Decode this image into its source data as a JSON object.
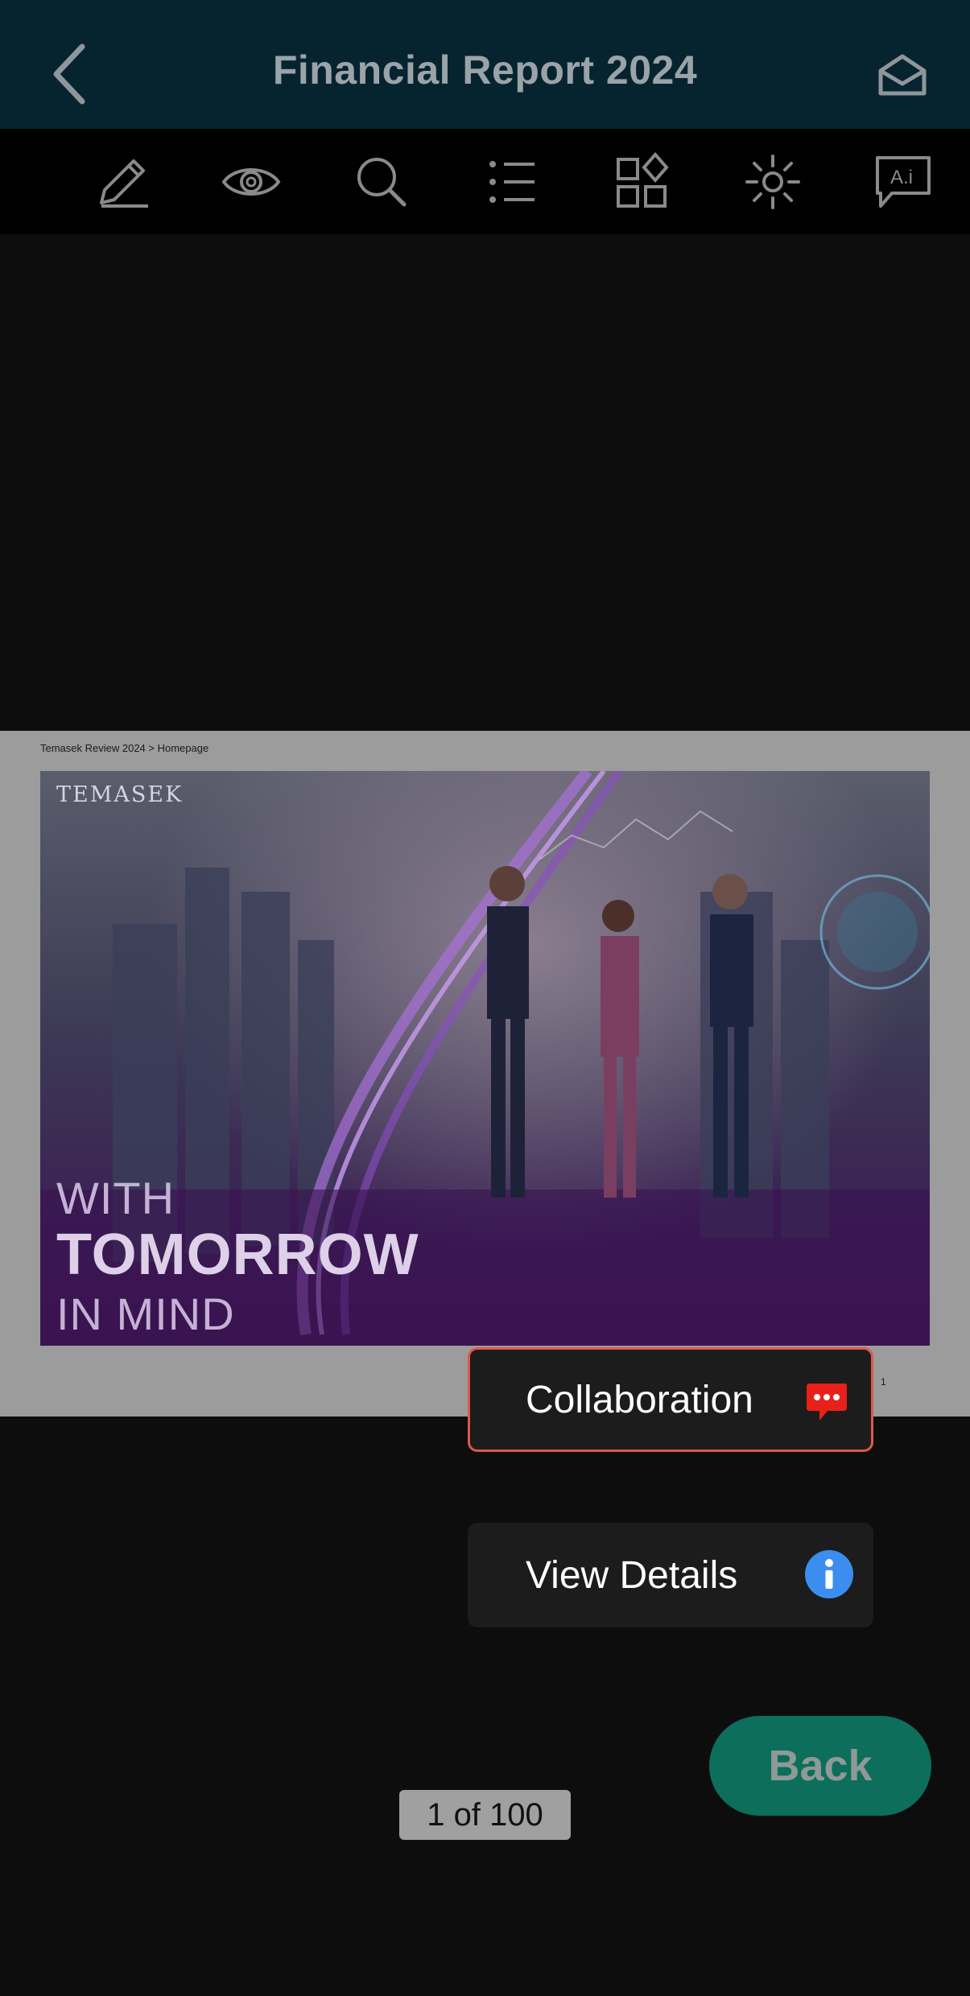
{
  "header": {
    "title": "Financial Report 2024",
    "back_icon": "chevron-left-icon",
    "mail_icon": "open-envelope-icon"
  },
  "toolbar": {
    "tools": [
      "pencil-icon",
      "eye-icon",
      "search-icon",
      "list-icon",
      "apps-icon",
      "brightness-icon",
      "ai-text-icon"
    ]
  },
  "document": {
    "breadcrumb": "Temasek Review 2024 > Homepage",
    "brand": "TEMASEK",
    "tagline_line1": "WITH",
    "tagline_line2": "TOMORROW",
    "tagline_line3": "IN MIND",
    "page_number": "1"
  },
  "context_menu": {
    "collaboration_label": "Collaboration",
    "collaboration_icon": "chat-bubble-icon",
    "view_details_label": "View Details",
    "view_details_icon": "info-icon"
  },
  "back_button": {
    "label": "Back"
  },
  "pager": {
    "text": "1 of 100"
  },
  "colors": {
    "header_bg": "#062430",
    "highlight_border": "#e0574a",
    "back_button_bg": "#0c6e5b",
    "chat_icon": "#e8201a",
    "info_icon": "#3c8df0"
  }
}
